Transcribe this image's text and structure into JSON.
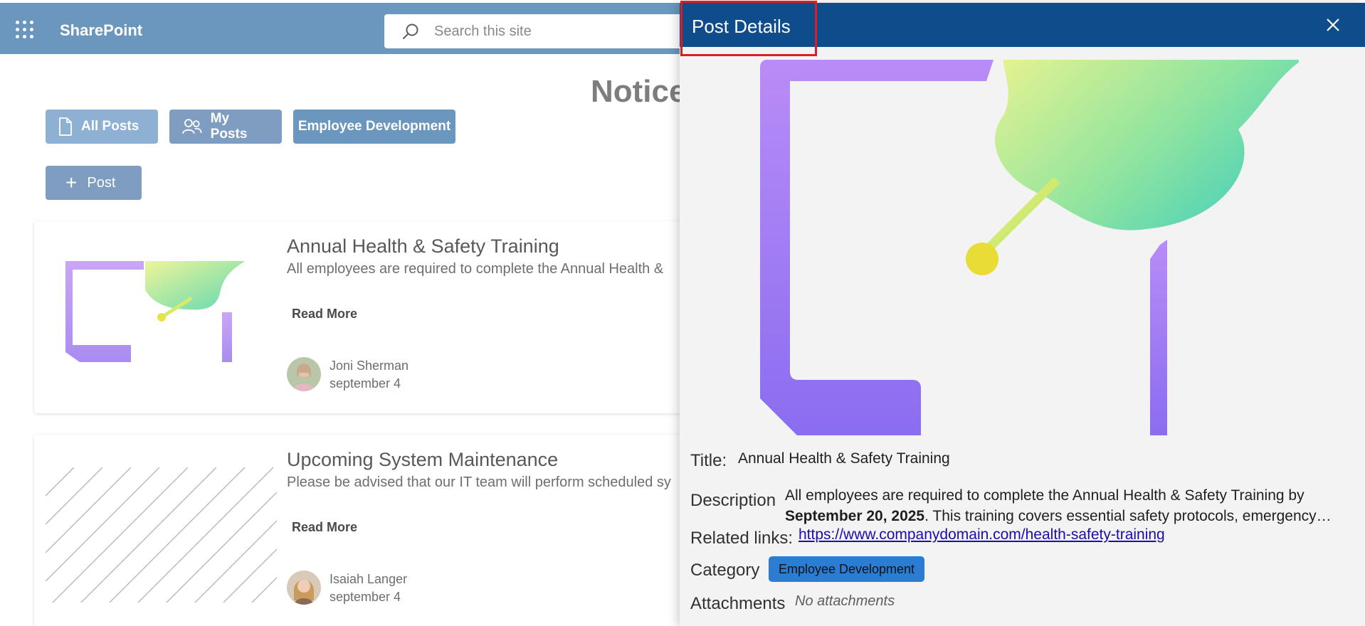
{
  "app": {
    "name": "SharePoint"
  },
  "search": {
    "placeholder": "Search this site"
  },
  "page": {
    "title": "Notice"
  },
  "filters": [
    {
      "label": "All Posts",
      "icon": "document-icon"
    },
    {
      "label": "My Posts",
      "icon": "people-icon"
    },
    {
      "label": "Employee Development"
    }
  ],
  "new_post": {
    "label": "Post"
  },
  "posts": [
    {
      "title": "Annual Health & Safety Training",
      "description": "All employees are required to complete the Annual Health &",
      "read_more": "Read More",
      "author": "Joni Sherman",
      "date": "september 4"
    },
    {
      "title": "Upcoming System Maintenance",
      "description": "Please be advised that our IT team will perform scheduled sy",
      "read_more": "Read More",
      "author": "Isaiah Langer",
      "date": "september 4"
    }
  ],
  "panel": {
    "title": "Post Details",
    "title_label": "Title:",
    "title_value": "Annual Health & Safety Training",
    "description_label": "Description",
    "description_line1": "All employees are required to complete the Annual Health & Safety Training by",
    "description_bold": "September 20, 2025",
    "description_line2_rest": ". This training covers essential safety protocols, emergency…",
    "related_label": "Related links:",
    "related_link": "https://www.companydomain.com/health-safety-training",
    "category_label": "Category",
    "category_value": "Employee Development",
    "attachments_label": "Attachments",
    "attachments_value": "No attachments"
  },
  "colors": {
    "suite_bar": "#6b96bd",
    "panel_header": "#0f4c8c",
    "category_chip": "#2b7cd3",
    "highlight_box": "#d81f26"
  }
}
